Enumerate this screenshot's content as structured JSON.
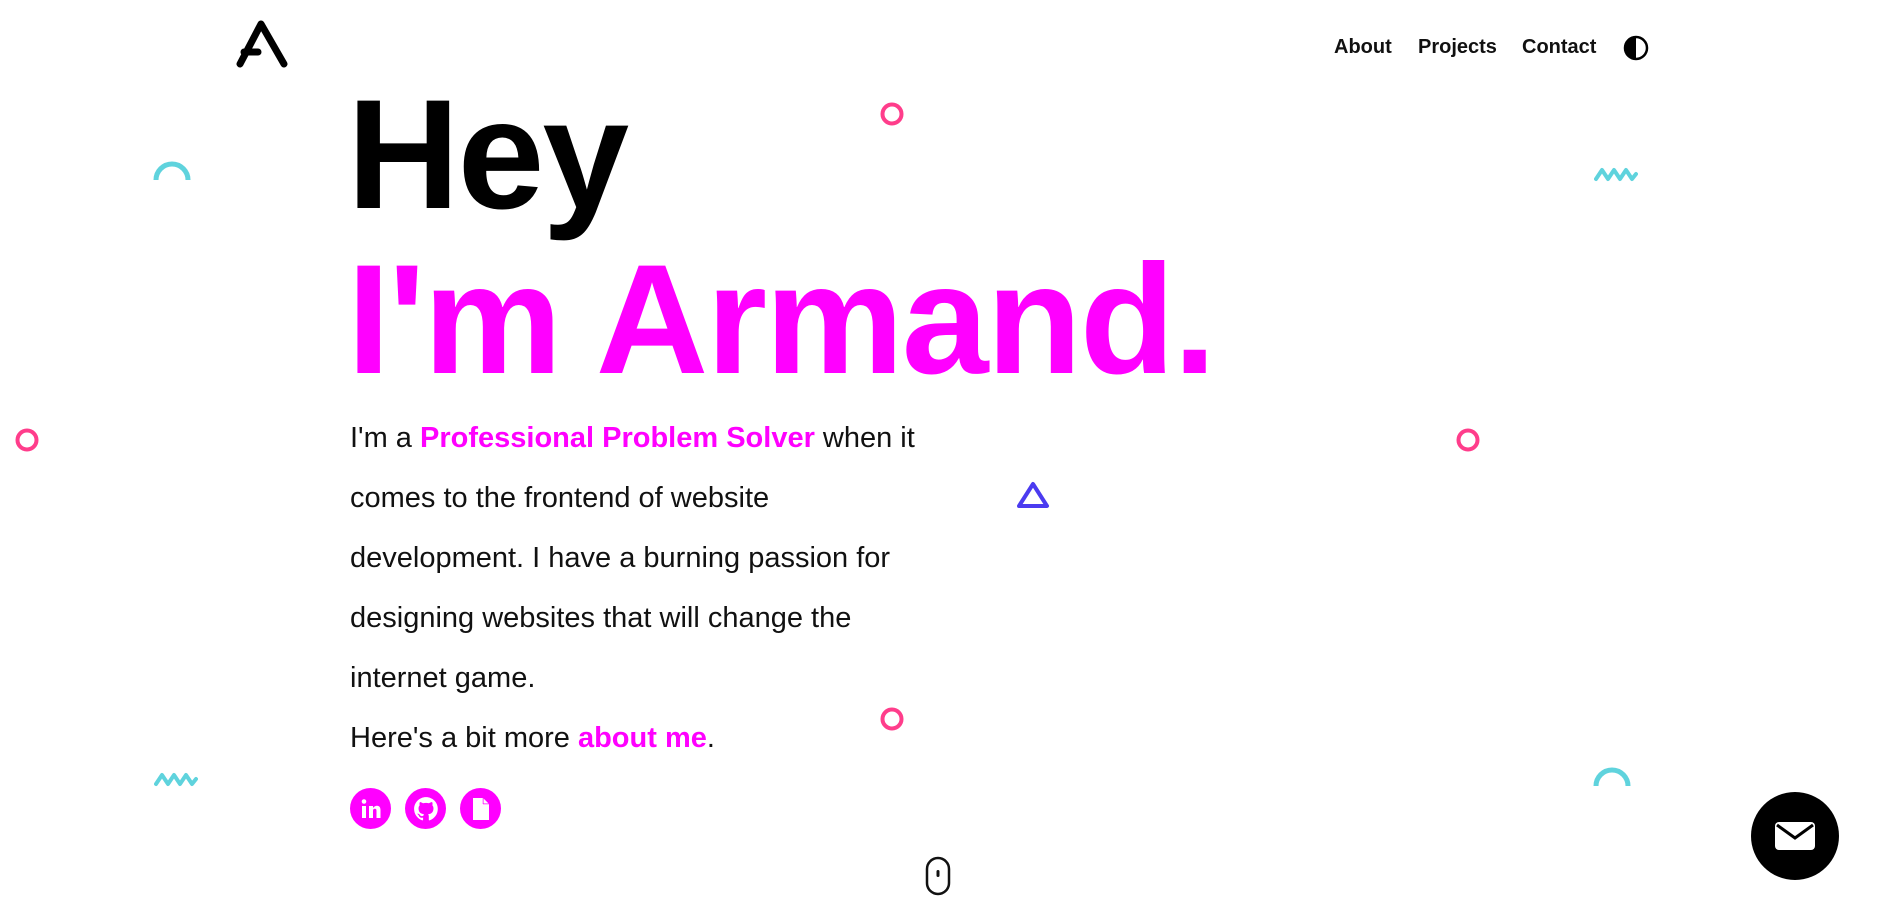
{
  "nav": {
    "items": [
      {
        "label": "About"
      },
      {
        "label": "Projects"
      },
      {
        "label": "Contact"
      }
    ]
  },
  "hero": {
    "greeting": "Hey",
    "name": "I'm Armand."
  },
  "bio": {
    "intro_prefix": "I'm a ",
    "highlight": "Professional Problem Solver",
    "intro_suffix": " when it comes to the frontend of website development. I have a burning passion for designing websites that will change the internet game.",
    "more_prefix": "Here's a bit more ",
    "more_link": "about me",
    "more_suffix": "."
  },
  "socials": [
    "linkedin-icon",
    "github-icon",
    "resume-icon"
  ],
  "colors": {
    "accent": "#ff00ff",
    "deco_pink": "#ff3d8b",
    "deco_cyan": "#5fd3dd",
    "deco_blue": "#4b3bf0",
    "text": "#111111"
  }
}
